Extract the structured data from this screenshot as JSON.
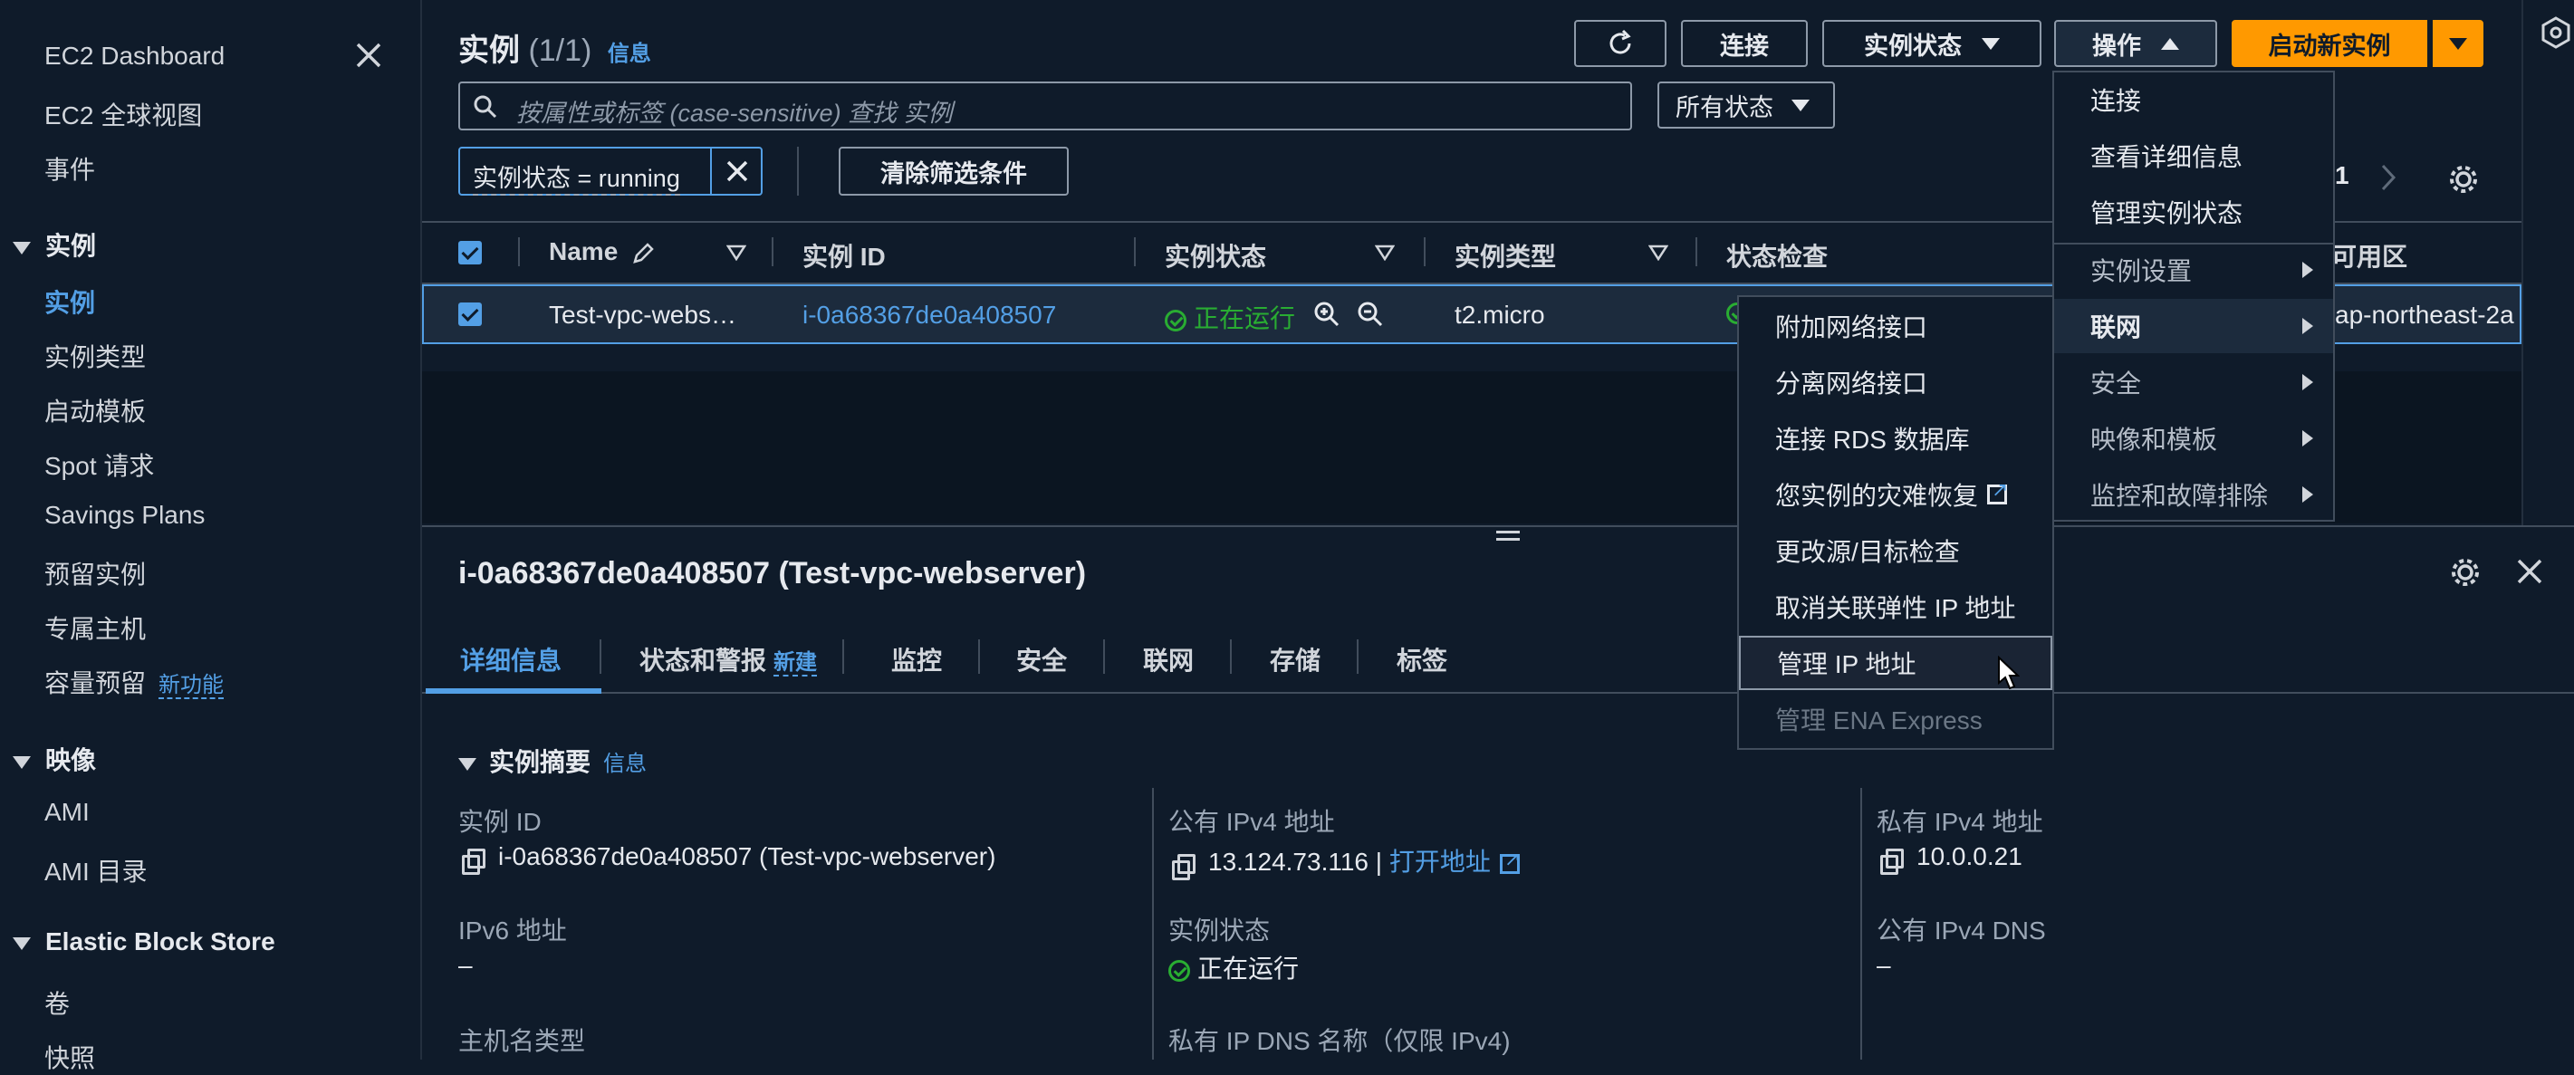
{
  "sidebar": {
    "items": [
      {
        "label": "EC2 Dashboard"
      },
      {
        "label": "EC2 全球视图"
      },
      {
        "label": "事件"
      }
    ],
    "sections": [
      {
        "title": "实例",
        "items": [
          "实例",
          "实例类型",
          "启动模板",
          "Spot 请求",
          "Savings Plans",
          "预留实例",
          "专属主机",
          "容量预留"
        ]
      },
      {
        "title": "映像",
        "items": [
          "AMI",
          "AMI 目录"
        ]
      },
      {
        "title": "Elastic Block Store",
        "items": [
          "卷",
          "快照"
        ]
      }
    ],
    "capacity_new": "新功能"
  },
  "header": {
    "title": "实例",
    "count": "(1/1)",
    "info": "信息",
    "buttons": {
      "connect": "连接",
      "instance_state": "实例状态",
      "actions": "操作",
      "launch": "启动新实例"
    }
  },
  "search": {
    "placeholder": "按属性或标签 (case-sensitive) 查找 实例",
    "state_filter": "所有状态"
  },
  "filter": {
    "token": "实例状态 = running",
    "clear": "清除筛选条件"
  },
  "pagination": {
    "page": "1"
  },
  "table": {
    "columns": [
      "Name",
      "实例 ID",
      "实例状态",
      "实例类型",
      "状态检查",
      "可用区"
    ],
    "row": {
      "name": "Test-vpc-webs…",
      "id": "i-0a68367de0a408507",
      "state": "正在运行",
      "type": "t2.micro",
      "az": "ap-northeast-2a"
    }
  },
  "details": {
    "title": "i-0a68367de0a408507 (Test-vpc-webserver)",
    "tabs": [
      "详细信息",
      "状态和警报",
      "监控",
      "安全",
      "联网",
      "存储",
      "标签"
    ],
    "alerts_new": "新建",
    "summary_title": "实例摘要",
    "summary_info": "信息",
    "fields": {
      "instance_id_label": "实例 ID",
      "instance_id_value": "i-0a68367de0a408507 (Test-vpc-webserver)",
      "ipv6_label": "IPv6 地址",
      "ipv6_value": "–",
      "hostname_label": "主机名类型",
      "public_ipv4_label": "公有 IPv4 地址",
      "public_ipv4_value": "13.124.73.116",
      "open_address": "打开地址",
      "state_label": "实例状态",
      "state_value": "正在运行",
      "private_dns_label": "私有 IP DNS 名称（仅限 IPv4)",
      "private_ipv4_label": "私有 IPv4 地址",
      "private_ipv4_value": "10.0.0.21",
      "public_dns_label": "公有 IPv4 DNS",
      "public_dns_value": "–"
    }
  },
  "actions_menu": {
    "items": [
      "连接",
      "查看详细信息",
      "管理实例状态",
      "实例设置",
      "联网",
      "安全",
      "映像和模板",
      "监控和故障排除"
    ]
  },
  "networking_submenu": {
    "items": [
      "附加网络接口",
      "分离网络接口",
      "连接 RDS 数据库",
      "您实例的灾难恢复",
      "更改源/目标检查",
      "取消关联弹性 IP 地址",
      "管理 IP 地址",
      "管理 ENA Express"
    ]
  },
  "colors": {
    "background": "#0f1b2a",
    "accent": "#539fe5",
    "primary": "#ff9900",
    "success": "#29ad32"
  }
}
